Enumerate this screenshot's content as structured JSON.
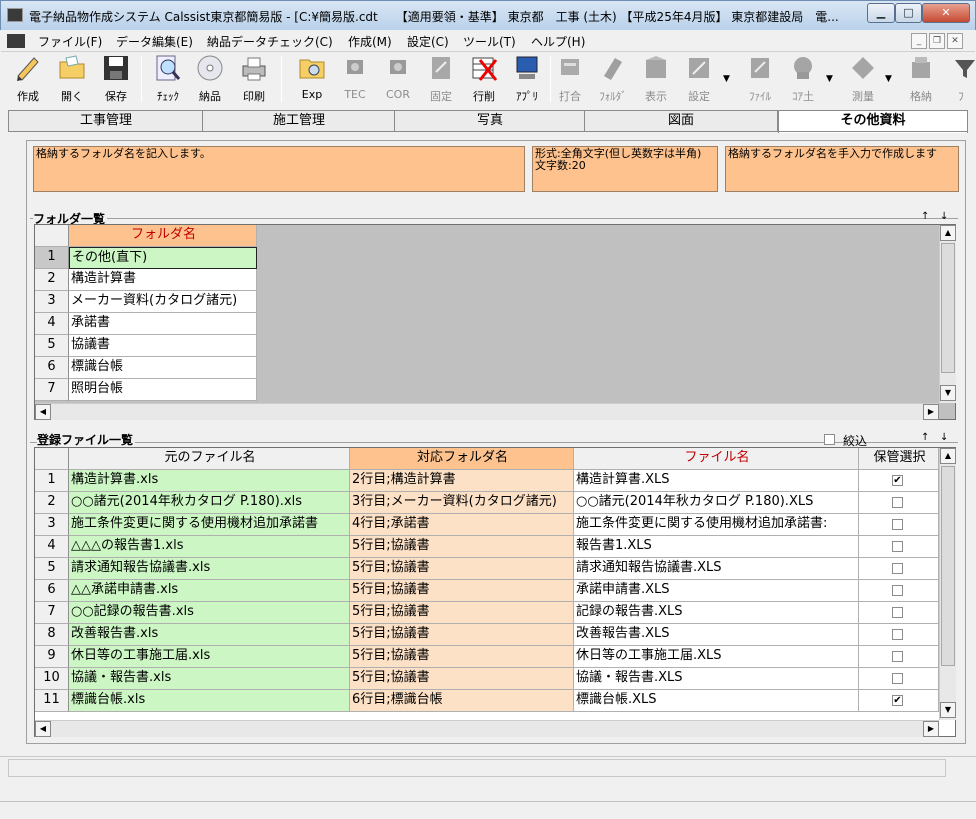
{
  "window": {
    "title": "電子納品物作成システム Calssist東京都簡易版 - [C:¥簡易版.cdt　　【適用要領・基準】 東京都　工事 (土木) 【平成25年4月版】 東京都建設局　電..."
  },
  "menu": [
    "ファイル(F)",
    "データ編集(E)",
    "納品データチェック(C)",
    "作成(M)",
    "設定(C)",
    "ツール(T)",
    "ヘルプ(H)"
  ],
  "toolbar": [
    {
      "label": "作成",
      "icon": "pen-icon",
      "enabled": true
    },
    {
      "label": "開く",
      "icon": "open-folder-icon",
      "enabled": true
    },
    {
      "label": "保存",
      "icon": "floppy-disk-icon",
      "enabled": true
    },
    {
      "label": "ﾁｪｯｸ",
      "icon": "magnifier-check-icon",
      "enabled": true
    },
    {
      "label": "納品",
      "icon": "cd-disc-icon",
      "enabled": true
    },
    {
      "label": "印刷",
      "icon": "printer-icon",
      "enabled": true
    },
    {
      "label": "Exp",
      "icon": "explorer-icon",
      "enabled": true
    },
    {
      "label": "TEC",
      "icon": "tec-icon",
      "enabled": false
    },
    {
      "label": "COR",
      "icon": "cor-icon",
      "enabled": false
    },
    {
      "label": "固定",
      "icon": "fixed-icon",
      "enabled": false
    },
    {
      "label": "行削",
      "icon": "delete-row-icon",
      "enabled": true
    },
    {
      "label": "ｱﾌﾟﾘ",
      "icon": "application-icon",
      "enabled": true
    },
    {
      "label": "打合",
      "icon": "meeting-icon",
      "enabled": false
    },
    {
      "label": "ﾌｫﾙﾀﾞ",
      "icon": "folder-tool-icon",
      "enabled": false
    },
    {
      "label": "表示",
      "icon": "display-icon",
      "enabled": false
    },
    {
      "label": "設定",
      "icon": "settings-icon",
      "enabled": false
    },
    {
      "label": "ﾌｧｲﾙ",
      "icon": "file-icon",
      "enabled": false
    },
    {
      "label": "ｺｱ土",
      "icon": "core-soil-icon",
      "enabled": false
    },
    {
      "label": "測量",
      "icon": "survey-icon",
      "enabled": false
    },
    {
      "label": "格納",
      "icon": "store-icon",
      "enabled": false
    },
    {
      "label": "ﾌ",
      "icon": "filter-icon",
      "enabled": false
    }
  ],
  "tabs": [
    "工事管理",
    "施工管理",
    "写真",
    "図面",
    "その他資料"
  ],
  "active_tab": 4,
  "info": {
    "description": "格納するフォルダ名を記入します。",
    "format": "形式:全角文字(但し英数字は半角)\n文字数:20",
    "note": "格納するフォルダ名を手入力で作成します"
  },
  "folder_list": {
    "title": "フォルダ一覧",
    "scroll_buttons": [
      "↑",
      "↓"
    ],
    "column_header": "フォルダ名",
    "rows": [
      {
        "no": "1",
        "name": "その他(直下)"
      },
      {
        "no": "2",
        "name": "構造計算書"
      },
      {
        "no": "3",
        "name": "メーカー資料(カタログ諸元)"
      },
      {
        "no": "4",
        "name": "承諾書"
      },
      {
        "no": "5",
        "name": "協議書"
      },
      {
        "no": "6",
        "name": "標識台帳"
      },
      {
        "no": "7",
        "name": "照明台帳"
      }
    ]
  },
  "file_list": {
    "title": "登録ファイル一覧",
    "filter_label": "絞込",
    "scroll_buttons": [
      "↑",
      "↓"
    ],
    "columns": [
      "元のファイル名",
      "対応フォルダ名",
      "ファイル名",
      "保管選択"
    ],
    "rows": [
      {
        "no": "1",
        "src": "構造計算書.xls",
        "folder": "2行目;構造計算書",
        "file": "構造計算書.XLS",
        "keep": true
      },
      {
        "no": "2",
        "src": "○○諸元(2014年秋カタログ P.180).xls",
        "folder": "3行目;メーカー資料(カタログ諸元)",
        "file": "○○諸元(2014年秋カタログ P.180).XLS",
        "keep": false
      },
      {
        "no": "3",
        "src": "施工条件変更に関する使用機材追加承諾書",
        "folder": "4行目;承諾書",
        "file": "施工条件変更に関する使用機材追加承諾書:",
        "keep": false
      },
      {
        "no": "4",
        "src": "△△△の報告書1.xls",
        "folder": "5行目;協議書",
        "file": "報告書1.XLS",
        "keep": false
      },
      {
        "no": "5",
        "src": "請求通知報告協議書.xls",
        "folder": "5行目;協議書",
        "file": "請求通知報告協議書.XLS",
        "keep": false
      },
      {
        "no": "6",
        "src": "△△承諾申請書.xls",
        "folder": "5行目;協議書",
        "file": "承諾申請書.XLS",
        "keep": false
      },
      {
        "no": "7",
        "src": "○○記録の報告書.xls",
        "folder": "5行目;協議書",
        "file": "記録の報告書.XLS",
        "keep": false
      },
      {
        "no": "8",
        "src": "改善報告書.xls",
        "folder": "5行目;協議書",
        "file": "改善報告書.XLS",
        "keep": false
      },
      {
        "no": "9",
        "src": "休日等の工事施工届.xls",
        "folder": "5行目;協議書",
        "file": "休日等の工事施工届.XLS",
        "keep": false
      },
      {
        "no": "10",
        "src": "協議・報告書.xls",
        "folder": "5行目;協議書",
        "file": "協議・報告書.XLS",
        "keep": false
      },
      {
        "no": "11",
        "src": "標識台帳.xls",
        "folder": "6行目;標識台帳",
        "file": "標識台帳.XLS",
        "keep": true
      }
    ]
  }
}
